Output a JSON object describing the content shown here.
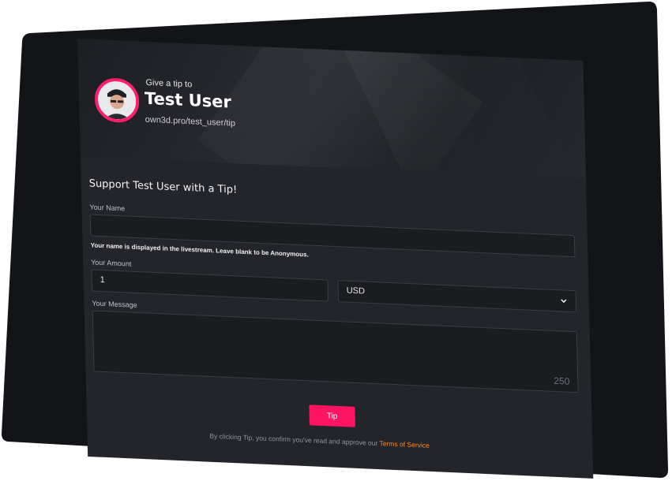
{
  "header": {
    "give_label": "Give a tip to",
    "user_name": "Test User",
    "profile_url": "own3d.pro/test_user/tip"
  },
  "form": {
    "heading": "Support Test User with a Tip!",
    "name_label": "Your Name",
    "name_value": "",
    "name_hint": "Your name is displayed in the livestream. Leave blank to be Anonymous.",
    "amount_label": "Your Amount",
    "amount_value": "1",
    "currency_selected": "USD",
    "message_label": "Your Message",
    "message_value": "",
    "char_counter": "250",
    "tip_button": "Tip",
    "legal_text": "By clicking Tip, you confirm you've read and approve our",
    "terms_link": "Terms of Service"
  },
  "colors": {
    "accent": "#ff1464",
    "link": "#ff8a1c",
    "avatar_ring": "#ff1f6d"
  },
  "icons": {
    "select_arrow": "chevron-down-icon"
  }
}
